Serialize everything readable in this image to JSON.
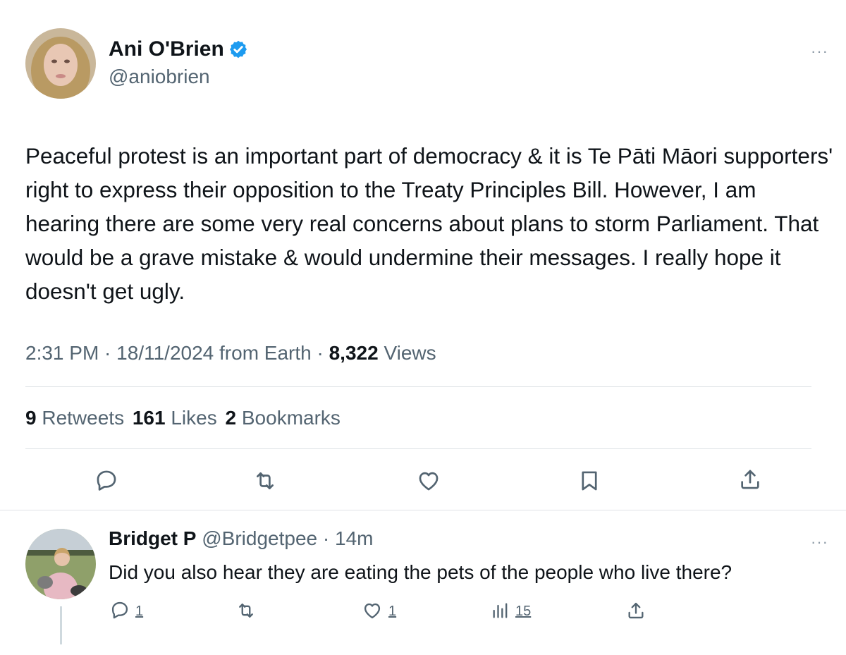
{
  "tweet": {
    "author_name": "Ani O'Brien",
    "author_handle": "@aniobrien",
    "verified_icon": "verified-badge-icon",
    "more_icon": "more-icon",
    "more_label": "···",
    "text": "Peaceful protest is an important part of democracy & it is Te Pāti Māori supporters' right to express their opposition to the Treaty Principles Bill. However, I am hearing there are some very real concerns about plans to storm Parliament. That would be a grave mistake & would undermine their messages. I really hope it doesn't get ugly.",
    "time": "2:31 PM",
    "sep1": " · ",
    "date": "18/11/2024",
    "source": " from Earth",
    "sep2": " · ",
    "views_count": "8,322",
    "views_label": " Views",
    "retweets_count": "9",
    "retweets_label": " Retweets",
    "likes_count": "161",
    "likes_label": " Likes",
    "bookmarks_count": "2",
    "bookmarks_label": " Bookmarks",
    "actions": [
      "reply-icon",
      "retweet-icon",
      "like-icon",
      "bookmark-icon",
      "share-icon"
    ]
  },
  "reply": {
    "author_name": "Bridget P",
    "author_handle": "@Bridgetpee",
    "sep": " · ",
    "age": "14m",
    "more_label": "···",
    "text": "Did you also hear they are eating the pets of the people who live there?",
    "reply_count": "1",
    "like_count": "1",
    "views_count": "15",
    "actions": [
      "reply-icon",
      "retweet-icon",
      "like-icon",
      "views-icon",
      "share-icon"
    ]
  },
  "colors": {
    "text": "#0f1419",
    "secondary": "#536471",
    "verified": "#1d9bf0",
    "divider": "#dfe3e6"
  }
}
